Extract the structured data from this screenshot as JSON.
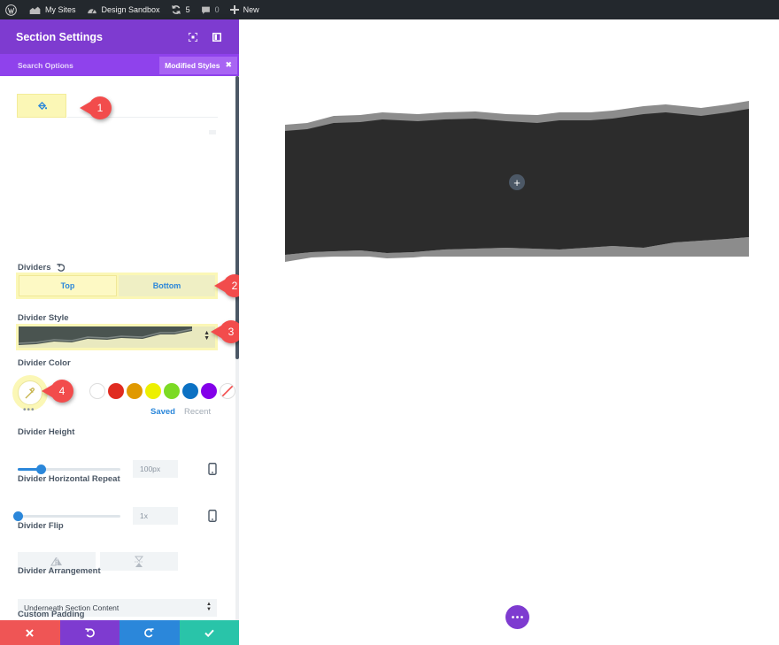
{
  "adminbar": {
    "my_sites": "My Sites",
    "site_name": "Design Sandbox",
    "updates_count": "5",
    "comments_count": "0",
    "new_label": "New"
  },
  "panel": {
    "title": "Section Settings",
    "search_options": "Search Options",
    "modified_styles": "Modified Styles",
    "modified_styles_close": "✖"
  },
  "dividers": {
    "label": "Dividers",
    "tab_top": "Top",
    "tab_bottom": "Bottom",
    "selected_tab": "Bottom"
  },
  "divider_style": {
    "label": "Divider Style"
  },
  "divider_color": {
    "label": "Divider Color",
    "swatches": [
      "#000000",
      "#ffffff",
      "#e02b20",
      "#e09900",
      "#edf000",
      "#7cda24",
      "#0c71c3",
      "#8300e9"
    ],
    "saved_label": "Saved",
    "recent_label": "Recent",
    "more": "•••"
  },
  "divider_height": {
    "label": "Divider Height",
    "value": "100px",
    "level": 0.22
  },
  "divider_repeat": {
    "label": "Divider Horizontal Repeat",
    "value": "1x",
    "level": 0.0
  },
  "divider_flip": {
    "label": "Divider Flip"
  },
  "divider_arrangement": {
    "label": "Divider Arrangement",
    "value": "Underneath Section Content"
  },
  "custom_padding": {
    "label": "Custom Padding"
  },
  "callouts": [
    "1",
    "2",
    "3",
    "4"
  ],
  "colors": {
    "header_purple": "#7e3bd0",
    "subheader_purple": "#8f42ec",
    "accent_blue": "#2b87da",
    "highlight_yellow": "#fbf7b6",
    "callout_red": "#f24c4c",
    "footer_cancel": "#ef5555",
    "footer_undo": "#7e3bd0",
    "footer_redo": "#2b87da",
    "footer_save": "#29c4a9",
    "section_dark": "#2c2c2c",
    "divider_gray": "#8c8c8c"
  }
}
